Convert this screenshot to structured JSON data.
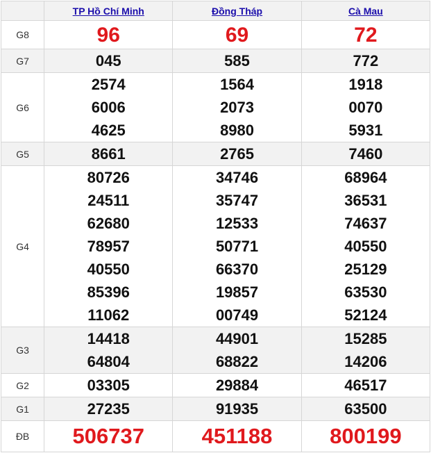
{
  "provinces": [
    "TP Hồ Chí Minh",
    "Đồng Tháp",
    "Cà Mau"
  ],
  "labels": {
    "g8": "G8",
    "g7": "G7",
    "g6": "G6",
    "g5": "G5",
    "g4": "G4",
    "g3": "G3",
    "g2": "G2",
    "g1": "G1",
    "db": "ĐB"
  },
  "results": {
    "g8": [
      "96",
      "69",
      "72"
    ],
    "g7": [
      "045",
      "585",
      "772"
    ],
    "g6": [
      [
        "2574",
        "6006",
        "4625"
      ],
      [
        "1564",
        "2073",
        "8980"
      ],
      [
        "1918",
        "0070",
        "5931"
      ]
    ],
    "g5": [
      "8661",
      "2765",
      "7460"
    ],
    "g4": [
      [
        "80726",
        "24511",
        "62680",
        "78957",
        "40550",
        "85396",
        "11062"
      ],
      [
        "34746",
        "35747",
        "12533",
        "50771",
        "66370",
        "19857",
        "00749"
      ],
      [
        "68964",
        "36531",
        "74637",
        "40550",
        "25129",
        "63530",
        "52124"
      ]
    ],
    "g3": [
      [
        "14418",
        "64804"
      ],
      [
        "44901",
        "68822"
      ],
      [
        "15285",
        "14206"
      ]
    ],
    "g2": [
      "03305",
      "29884",
      "46517"
    ],
    "g1": [
      "27235",
      "91935",
      "63500"
    ],
    "db": [
      "506737",
      "451188",
      "800199"
    ]
  },
  "colors": {
    "header_link": "#1a0dab",
    "highlight_red": "#e0191d",
    "row_shade": "#f2f2f2",
    "border": "#d6d6d6"
  }
}
